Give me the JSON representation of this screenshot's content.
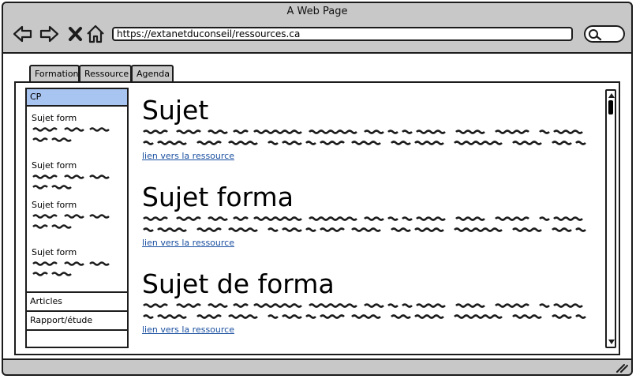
{
  "window": {
    "title": "A Web Page"
  },
  "browser": {
    "url": "https://extanetduconseil/ressources.ca",
    "icons": [
      "back-arrow-icon",
      "forward-arrow-icon",
      "close-icon",
      "home-icon",
      "search-icon"
    ]
  },
  "tabs": [
    {
      "label": "Formation"
    },
    {
      "label": "Ressource"
    },
    {
      "label": "Agenda"
    }
  ],
  "sidebar": {
    "header": "CP",
    "items": [
      {
        "label": "Sujet form"
      },
      {
        "label": "Sujet form"
      },
      {
        "label": "Sujet form"
      },
      {
        "label": "Sujet form"
      }
    ],
    "rows": [
      {
        "label": "Articles"
      },
      {
        "label": "Rapport/étude"
      }
    ]
  },
  "articles": [
    {
      "title": "Sujet",
      "link": "lien vers la ressource"
    },
    {
      "title": "Sujet forma",
      "link": "lien vers la ressource"
    },
    {
      "title": "Sujet de forma",
      "link": "lien vers la ressource"
    }
  ],
  "colors": {
    "chrome": "#c8c8c8",
    "selection": "#a8c4f0",
    "link": "#1a4fa0",
    "ink": "#1c1c1c"
  }
}
